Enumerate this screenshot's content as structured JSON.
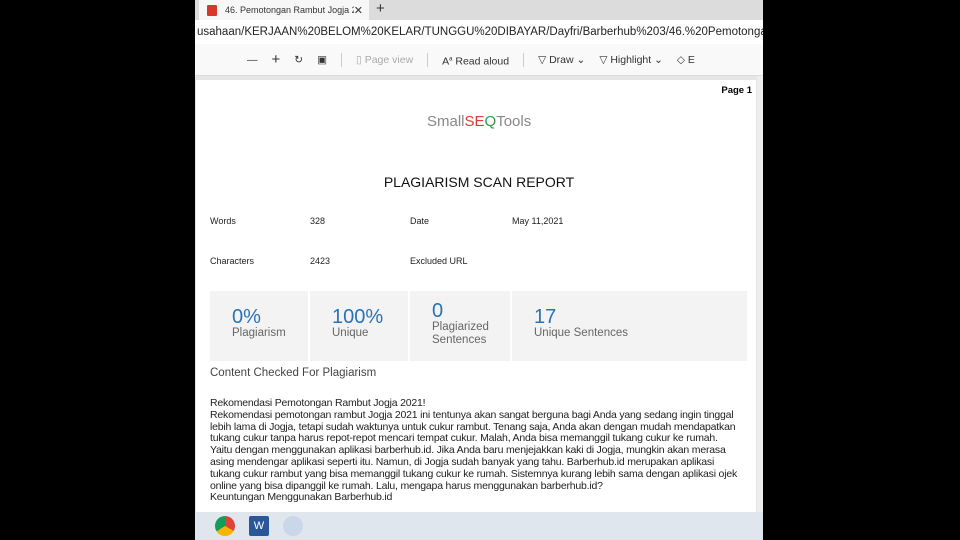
{
  "browser": {
    "tab_title": "46. Pemotongan Rambut Jogja 2",
    "address": "usahaan/KERJAAN%20BELOM%20KELAR/TUNGGU%20DIBAYAR/Dayfri/Barberhub%203/46.%20Pemotongan...",
    "toolbar": {
      "zoom_out": "—",
      "zoom_in": "+",
      "page_view": "Page view",
      "read_aloud": "Read aloud",
      "draw": "Draw",
      "highlight": "Highlight",
      "erase": "E"
    }
  },
  "page": {
    "page_label": "Page 1",
    "logo": {
      "a": "Small",
      "b": "SE",
      "c": "Q",
      "d": "Tools"
    },
    "title": "PLAGIARISM SCAN REPORT",
    "words_label": "Words",
    "words": "328",
    "date_label": "Date",
    "date": "May 11,2021",
    "chars_label": "Characters",
    "chars": "2423",
    "excluded_label": "Excluded URL",
    "stats": [
      {
        "value": "0%",
        "label": "Plagiarism"
      },
      {
        "value": "100%",
        "label": "Unique"
      },
      {
        "value": "0",
        "label": "Plagiarized Sentences"
      },
      {
        "value": "17",
        "label": "Unique Sentences"
      }
    ],
    "checked_heading": "Content Checked For Plagiarism",
    "lines": [
      "Rekomendasi Pemotongan Rambut Jogja 2021!",
      "Rekomendasi pemotongan rambut Jogja 2021 ini tentunya akan sangat berguna bagi Anda yang sedang ingin tinggal",
      "lebih lama di Jogja, tetapi sudah waktunya untuk cukur rambut. Tenang saja, Anda akan dengan mudah mendapatkan",
      "tukang cukur tanpa harus repot-repot mencari tempat cukur. Malah, Anda bisa memanggil tukang cukur ke rumah.",
      "Yaitu dengan menggunakan aplikasi barberhub.id. Jika Anda baru menjejakkan kaki di Jogja, mungkin akan merasa",
      "asing mendengar aplikasi seperti itu. Namun, di Jogja sudah banyak yang tahu. Barberhub.id merupakan aplikasi",
      "tukang cukur rambut yang bisa memanggil tukang cukur ke rumah. Sistemnya kurang lebih sama dengan aplikasi ojek",
      "online yang bisa dipanggil ke rumah. Lalu, mengapa harus menggunakan barberhub.id?",
      "Keuntungan Menggunakan Barberhub.id"
    ]
  }
}
